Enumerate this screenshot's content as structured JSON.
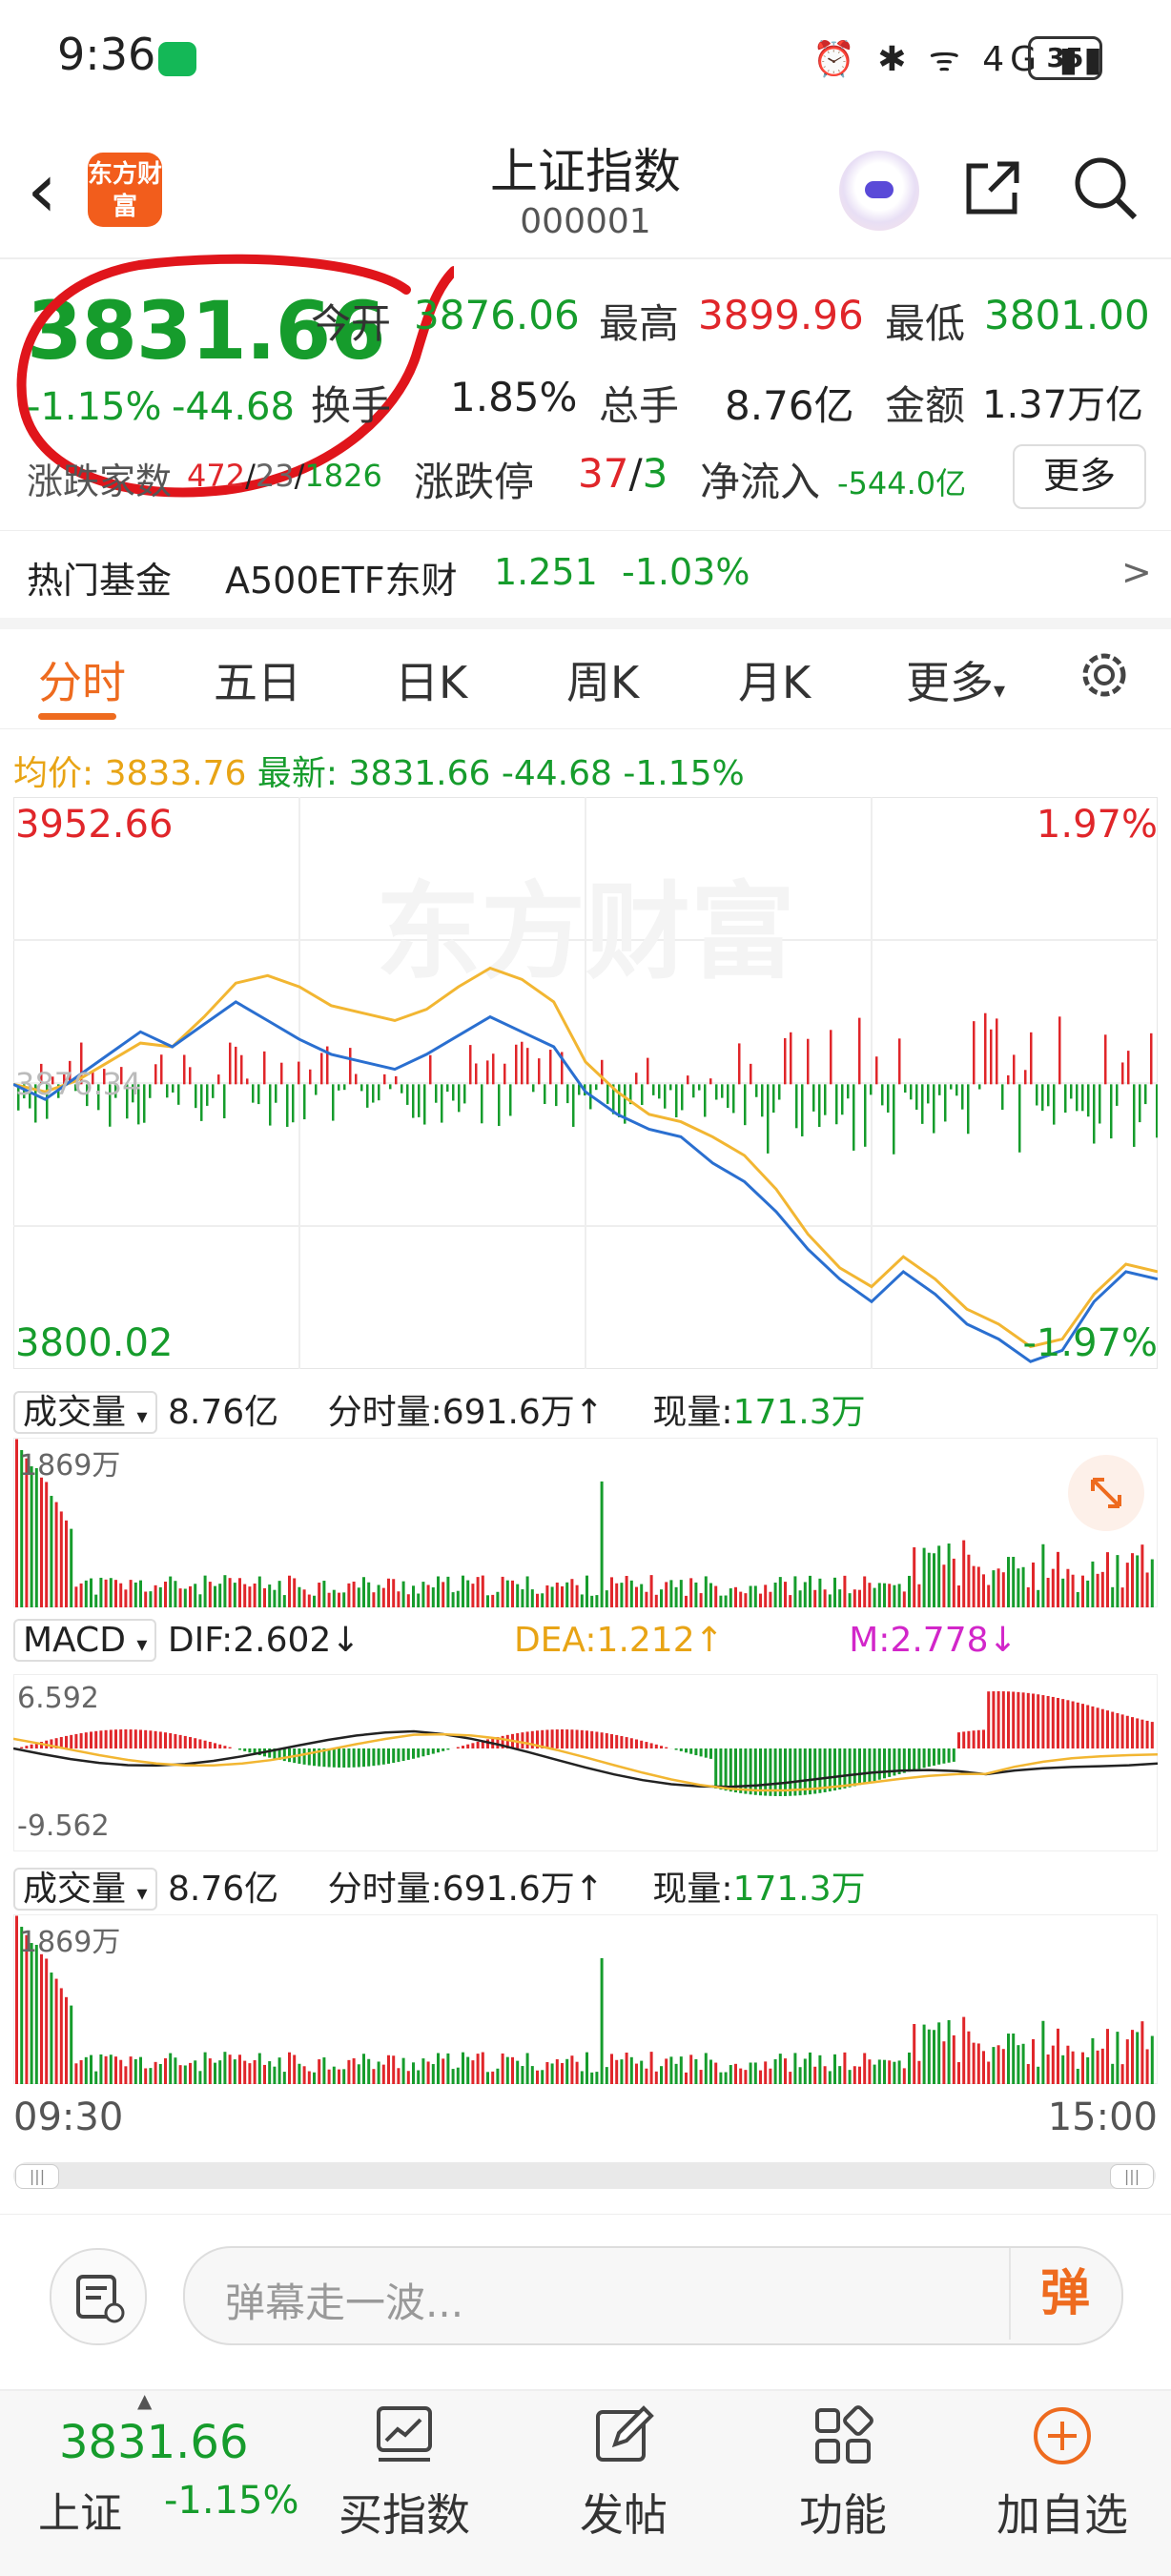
{
  "status_bar": {
    "time": "9:36",
    "battery": "35",
    "network": "4G"
  },
  "header": {
    "title": "上证指数",
    "code": "000001",
    "logo_text": "东方财富"
  },
  "quote": {
    "price": "3831.66",
    "change_pct": "-1.15%",
    "change": "-44.68",
    "open_label": "今开",
    "open": "3876.06",
    "high_label": "最高",
    "high": "3899.96",
    "low_label": "最低",
    "low": "3801.00",
    "turnover_label": "换手",
    "turnover": "1.85%",
    "volume_label": "总手",
    "volume": "8.76亿",
    "amount_label": "金额",
    "amount": "1.37万亿",
    "breadth_label": "涨跌家数",
    "up_count": "472",
    "flat_count": "23",
    "down_count": "1826",
    "limit_label": "涨跌停",
    "limit_up": "37",
    "limit_down": "3",
    "netflow_label": "净流入",
    "netflow": "-544.0亿",
    "more_button": "更多"
  },
  "hot_fund": {
    "label": "热门基金",
    "name": "A500ETF东财",
    "price": "1.251",
    "pct": "-1.03%",
    "arrow": ">"
  },
  "tabs": [
    "分时",
    "五日",
    "日K",
    "周K",
    "月K",
    "更多"
  ],
  "active_tab": "分时",
  "chart_info": {
    "avg_label": "均价:",
    "avg": "3833.76",
    "latest_label": "最新:",
    "latest": "3831.66",
    "change": "-44.68",
    "pct": "-1.15%"
  },
  "chart_data": {
    "type": "line",
    "ylim": [
      3800.02,
      3952.66
    ],
    "y_top_label": "3952.66",
    "y_bottom_label": "3800.02",
    "right_top_label": "1.97%",
    "right_bottom_label": "-1.97%",
    "mid_label": "3876.34",
    "watermark": "东方财富",
    "x_start": "09:30",
    "x_end": "15:00",
    "series": [
      {
        "values": [
          3876,
          3872,
          3878,
          3884,
          3890,
          3886,
          3892,
          3898,
          3893,
          3888,
          3884,
          3882,
          3880,
          3884,
          3889,
          3894,
          3890,
          3886,
          3874,
          3868,
          3864,
          3862,
          3855,
          3850,
          3842,
          3832,
          3824,
          3818,
          3826,
          3820,
          3812,
          3808,
          3802,
          3805,
          3818,
          3826,
          3824
        ]
      },
      {
        "values": [
          3876,
          3874,
          3877,
          3882,
          3887,
          3886,
          3894,
          3903,
          3905,
          3902,
          3897,
          3895,
          3893,
          3896,
          3902,
          3907,
          3904,
          3898,
          3882,
          3874,
          3868,
          3866,
          3862,
          3857,
          3848,
          3836,
          3827,
          3822,
          3830,
          3824,
          3816,
          3812,
          3806,
          3808,
          3820,
          3828,
          3826
        ]
      }
    ]
  },
  "volume_panel": {
    "label": "成交量",
    "total": "8.76亿",
    "slot_label": "分时量:",
    "slot_value": "691.6万",
    "now_label": "现量:",
    "now_value": "171.3万",
    "max_label": "1869万"
  },
  "macd_panel": {
    "label": "MACD",
    "dif_label": "DIF:",
    "dif": "2.602",
    "dea_label": "DEA:",
    "dea": "1.212",
    "m_label": "M:",
    "m": "2.778",
    "top": "6.592",
    "bottom": "-9.562"
  },
  "danmu": {
    "placeholder": "弹幕走一波...",
    "button": "弹"
  },
  "bottom_bar": {
    "price": "3831.66",
    "name": "上证",
    "pct": "-1.15%",
    "items": [
      "买指数",
      "发帖",
      "功能",
      "加自选"
    ]
  },
  "colors": {
    "accent": "#ee6b1f",
    "up": "#e0262a",
    "down": "#169c2c",
    "avg_line": "#f2b632",
    "price_line": "#2a6fd0"
  }
}
